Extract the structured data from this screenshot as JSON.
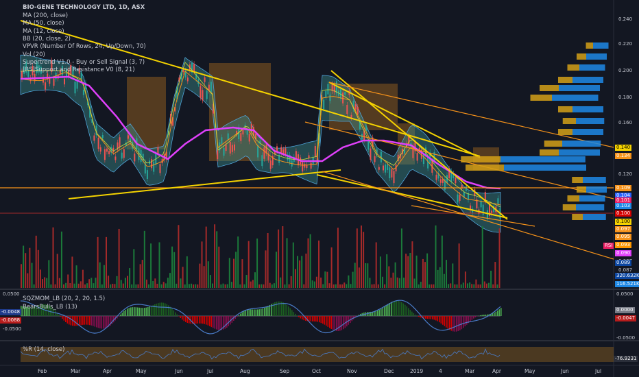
{
  "title": "BIO-GENE TECHNOLOGY LTD, 1D, ASX",
  "indicators": [
    "MA (200, close)",
    "MA (50, close)",
    "MA (12, close)",
    "BB (20, close, 2)",
    "VPVR (Number Of Rows, 24, Up/Down, 70)",
    "Vol (20)",
    "Supertrend V1.0 - Buy or Sell Signal (3, 7)",
    "[RS]Support and Resistance V0 (8, 21)"
  ],
  "price_axis": [
    "0.240",
    "0.220",
    "0.200",
    "0.180",
    "0.160",
    "0.120",
    "0.087",
    "0.087"
  ],
  "price_tags": [
    {
      "text": "0.140",
      "bg": "#f5d300",
      "fg": "#000"
    },
    {
      "text": "0.134",
      "bg": "#f7931a",
      "fg": "#fff"
    },
    {
      "text": "0.109",
      "bg": "#f7931a",
      "fg": "#fff"
    },
    {
      "text": "0.104",
      "bg": "#2962ff",
      "fg": "#fff"
    },
    {
      "text": "0.101",
      "bg": "#e91e63",
      "fg": "#fff"
    },
    {
      "text": "0.103",
      "bg": "#1e88e5",
      "fg": "#fff"
    },
    {
      "text": "0.100",
      "bg": "#d50000",
      "fg": "#fff"
    },
    {
      "text": "0.100",
      "bg": "#f5d300",
      "fg": "#000"
    },
    {
      "text": "0.097",
      "bg": "#f7931a",
      "fg": "#fff"
    },
    {
      "text": "0.095",
      "bg": "#f7931a",
      "fg": "#fff"
    },
    {
      "text": "0.093",
      "bg": "#ff9800",
      "fg": "#fff"
    },
    {
      "text": "0.090",
      "bg": "#e040fb",
      "fg": "#fff"
    },
    {
      "text": "0.089",
      "bg": "#0d47a1",
      "fg": "#fff"
    },
    {
      "text": "320.632K",
      "bg": "#0d47a1",
      "fg": "#fff"
    },
    {
      "text": "116.521K",
      "bg": "#1e88e5",
      "fg": "#fff"
    }
  ],
  "rsi_label": "RSI",
  "sqz": {
    "label": "SQZMOM_LB (20, 2, 20, 1.5)",
    "label2": "BearsBulls_LB (13)",
    "left_top": "0.0500",
    "left_mid": "-0.0048",
    "left_mid2": "-0.0088",
    "left_bot": "-0.0500",
    "right_top": "0.0500",
    "right_mid": "0.0000",
    "right_mid2": "-0.0047",
    "right_bot": "-0.0500"
  },
  "wr": {
    "label": "%R (14, close)",
    "value": "-76.9231"
  },
  "x_labels": [
    "Feb",
    "Mar",
    "Apr",
    "May",
    "Jun",
    "Jul",
    "Aug",
    "Sep",
    "Oct",
    "Nov",
    "Dec",
    "2019",
    "4",
    "Mar",
    "Apr",
    "May",
    "Jun",
    "Jul"
  ]
}
